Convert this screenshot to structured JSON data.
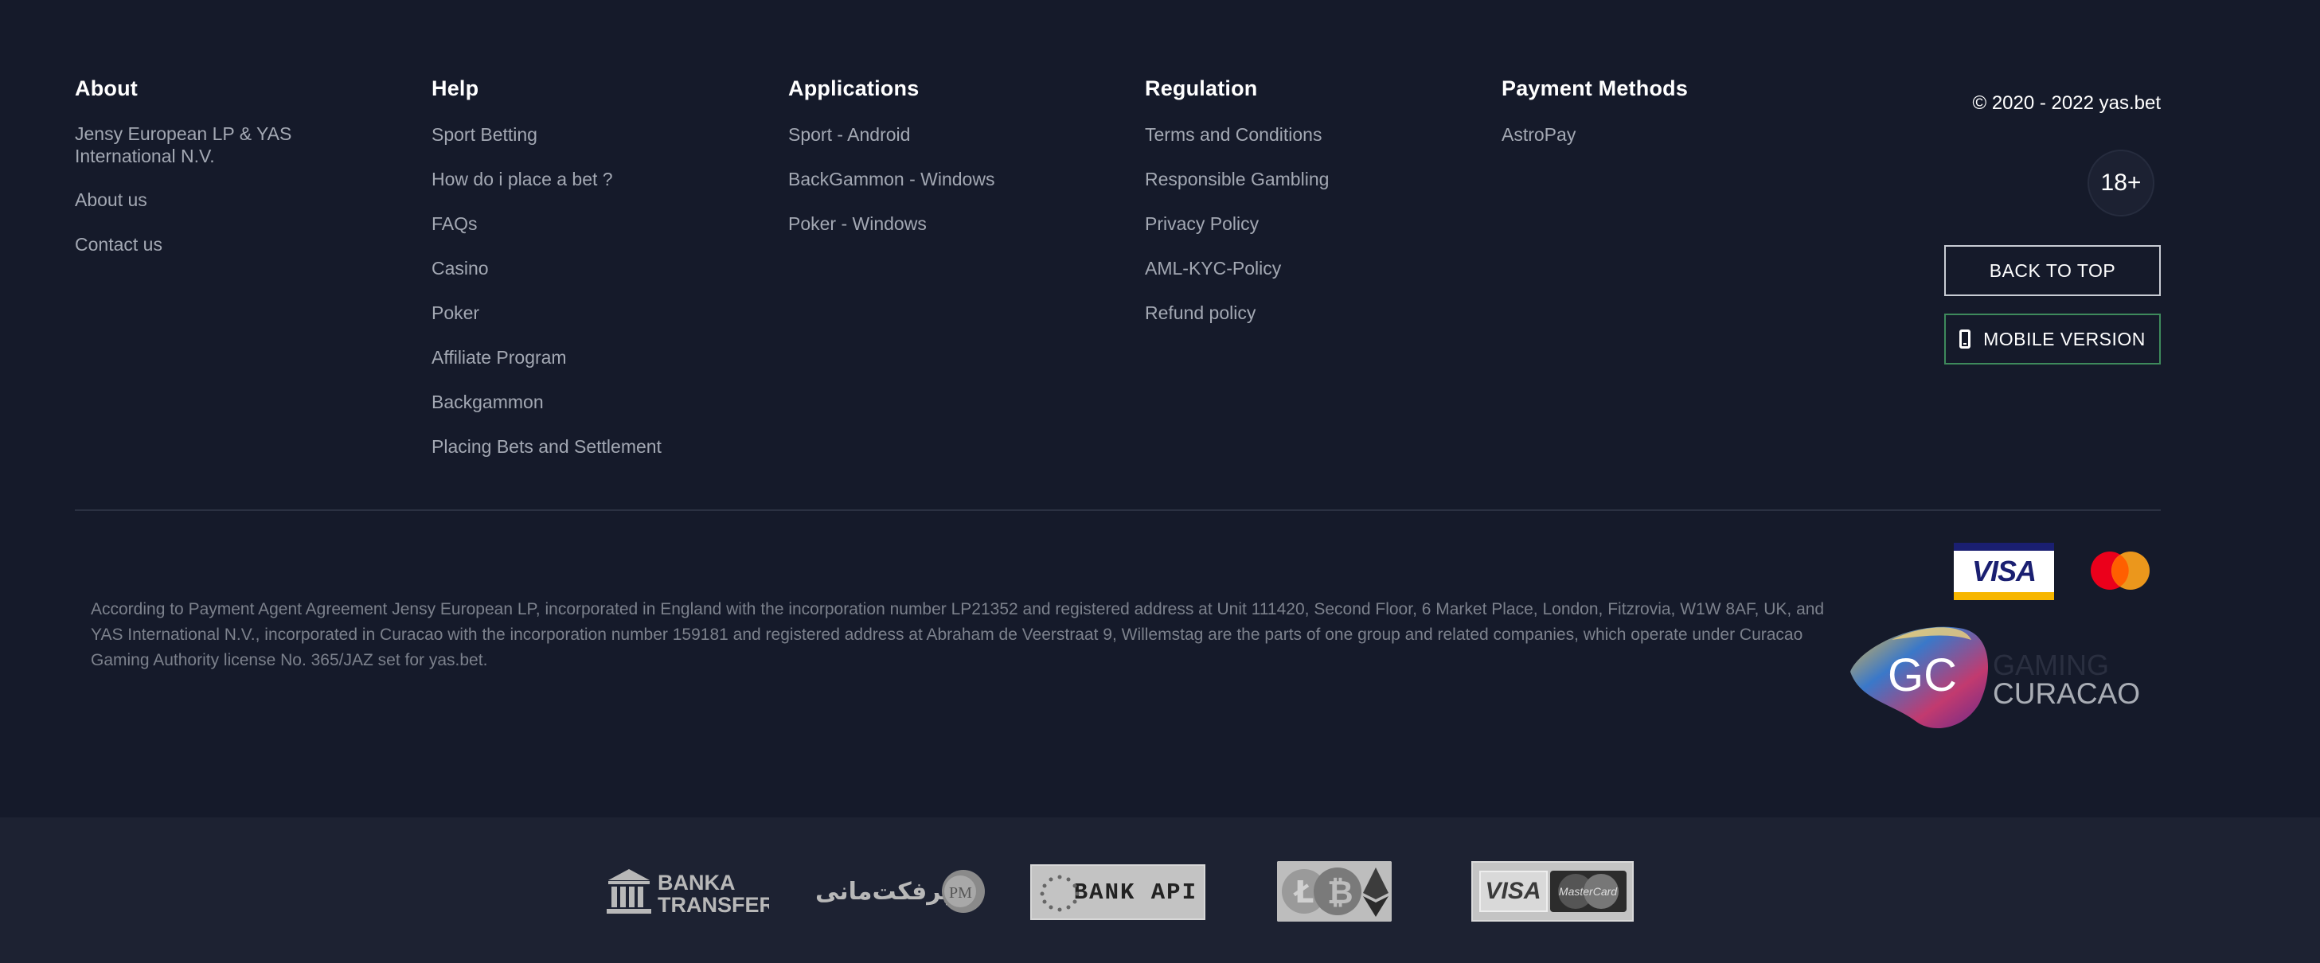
{
  "columns": {
    "about": {
      "heading": "About",
      "items": [
        "Jensy European LP & YAS International N.V.",
        "About us",
        "Contact us"
      ]
    },
    "help": {
      "heading": "Help",
      "items": [
        "Sport Betting",
        "How do i place a bet ?",
        "FAQs",
        "Casino",
        "Poker",
        "Affiliate Program",
        "Backgammon",
        "Placing Bets and Settlement"
      ]
    },
    "applications": {
      "heading": "Applications",
      "items": [
        "Sport - Android",
        "BackGammon - Windows",
        "Poker - Windows"
      ]
    },
    "regulation": {
      "heading": "Regulation",
      "items": [
        "Terms and Conditions",
        "Responsible Gambling",
        "Privacy Policy",
        "AML-KYC-Policy",
        "Refund policy"
      ]
    },
    "payment": {
      "heading": "Payment Methods",
      "items": [
        "AstroPay"
      ]
    }
  },
  "right": {
    "copyright": "© 2020 - 2022 yas.bet",
    "age_badge": "18+",
    "back_to_top": "BACK TO TOP",
    "mobile_version": "MOBILE VERSION"
  },
  "legal_text": "According to Payment Agent Agreement Jensy European LP, incorporated in England with the incorporation number LP21352 and registered address at Unit 111420, Second Floor, 6 Market Place, London, Fitzrovia, W1W 8AF, UK, and YAS International N.V., incorporated in Curacao with the incorporation number 159181 and registered address at Abraham de Veerstraat 9, Willemstag are the parts of one group and related companies, which operate under Curacao Gaming Authority license No. 365/JAZ set for yas.bet.",
  "logos": {
    "visa": "VISA",
    "gc_initials": "GC",
    "gc_top": "GAMING",
    "gc_bottom": "CURACAO",
    "banka_line1": "BANKA",
    "banka_line2": "TRANSFER",
    "perfect_money": "پرفکت‌مانی",
    "pm_initials": "PM",
    "bank_api": "BANK API",
    "visa_small": "VISA",
    "mastercard_small": "MasterCard"
  },
  "colors": {
    "background": "#151a2a",
    "bottom_bar": "#1d2232",
    "mobile_border": "#3e8a5c",
    "mastercard_red": "#eb001b",
    "mastercard_orange": "#f79e1b"
  }
}
